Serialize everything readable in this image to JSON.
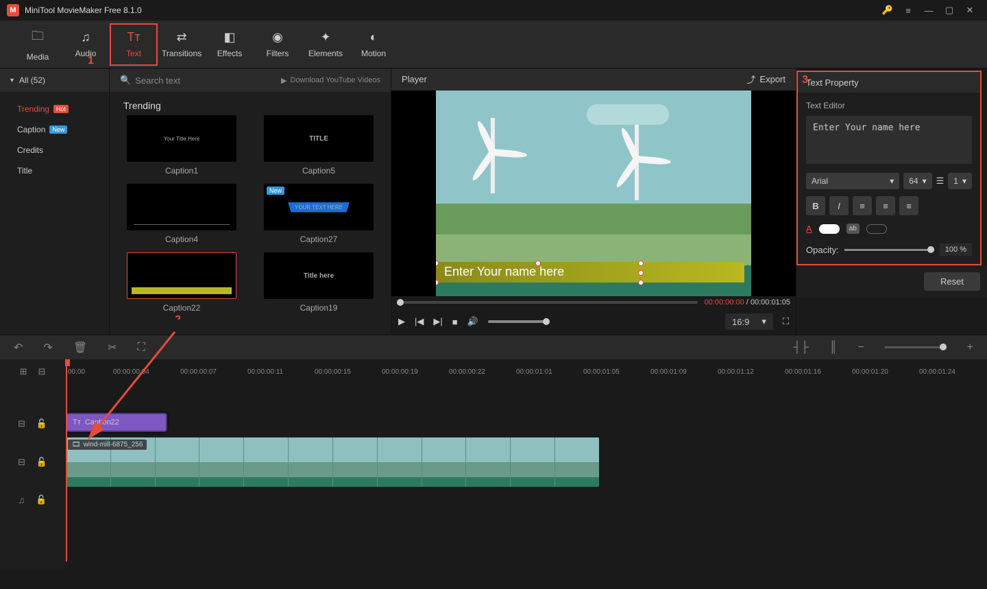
{
  "app": {
    "title": "MiniTool MovieMaker Free 8.1.0"
  },
  "tabs": {
    "media": "Media",
    "audio": "Audio",
    "text": "Text",
    "transitions": "Transitions",
    "effects": "Effects",
    "filters": "Filters",
    "elements": "Elements",
    "motion": "Motion"
  },
  "sidebar": {
    "all_label": "All (52)",
    "cats": {
      "trending": "Trending",
      "trending_badge": "Hot",
      "caption": "Caption",
      "caption_badge": "New",
      "credits": "Credits",
      "title": "Title"
    }
  },
  "gallery": {
    "search_placeholder": "Search text",
    "yt_link": "Download YouTube Videos",
    "section": "Trending",
    "items": {
      "c1": "Caption1",
      "c5": "Caption5",
      "c4": "Caption4",
      "c27": "Caption27",
      "c22": "Caption22",
      "c19": "Caption19"
    },
    "thumb_text": {
      "c1_line1": "Your Title Here",
      "c5_line1": "TITLE",
      "c4_line1": "",
      "c27_line1": "YOUR TEXT HERE",
      "c19_line1": "Title here"
    },
    "badge_new": "New"
  },
  "player": {
    "label": "Player",
    "export": "Export",
    "caption_text": "Enter Your name here",
    "time_current": "00:00:00:00",
    "time_sep": " / ",
    "time_total": "00:00:01:05",
    "aspect": "16:9"
  },
  "text_property": {
    "header": "Text Property",
    "editor_label": "Text Editor",
    "text_value": "Enter Your name here",
    "font": "Arial",
    "size": "64",
    "line": "1",
    "opacity_label": "Opacity:",
    "opacity_value": "100 %",
    "reset": "Reset"
  },
  "annotations": {
    "n1": "1",
    "n2": "2",
    "n3": "3"
  },
  "timeline": {
    "ruler": [
      "00:00",
      "00:00:00:04",
      "00:00:00:07",
      "00:00:00:11",
      "00:00:00:15",
      "00:00:00:19",
      "00:00:00:22",
      "00:00:01:01",
      "00:00:01:05",
      "00:00:01:09",
      "00:00:01:12",
      "00:00:01:16",
      "00:00:01:20",
      "00:00:01:24"
    ],
    "text_clip": "Caption22",
    "video_clip": "wind-mill-6875_256"
  }
}
